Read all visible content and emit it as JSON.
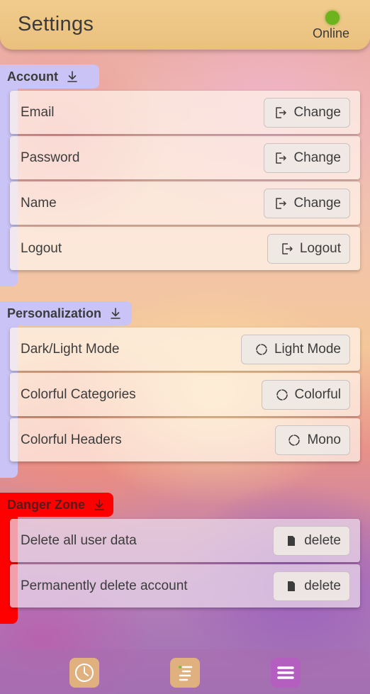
{
  "header": {
    "title": "Settings",
    "status": "Online",
    "status_color": "#6db31e"
  },
  "sections": {
    "account": {
      "title": "Account",
      "color": "#c9c3f6",
      "rows": [
        {
          "label": "Email",
          "button": "Change",
          "icon": "export-icon"
        },
        {
          "label": "Password",
          "button": "Change",
          "icon": "export-icon"
        },
        {
          "label": "Name",
          "button": "Change",
          "icon": "export-icon"
        },
        {
          "label": "Logout",
          "button": "Logout",
          "icon": "export-icon"
        }
      ]
    },
    "personalization": {
      "title": "Personalization",
      "color": "#c9c3f6",
      "rows": [
        {
          "label": "Dark/Light Mode",
          "button": "Light Mode",
          "icon": "refresh-icon"
        },
        {
          "label": "Colorful Categories",
          "button": "Colorful",
          "icon": "refresh-icon"
        },
        {
          "label": "Colorful Headers",
          "button": "Mono",
          "icon": "refresh-icon"
        }
      ]
    },
    "danger": {
      "title": "Danger Zone",
      "color": "#ff0000",
      "rows": [
        {
          "label": "Delete all user data",
          "button": "delete",
          "icon": "trash-icon"
        },
        {
          "label": "Permanently delete account",
          "button": "delete",
          "icon": "trash-icon"
        }
      ]
    }
  },
  "bottom_nav": {
    "items": [
      {
        "icon": "clock-icon",
        "color": "#e0b07f"
      },
      {
        "icon": "task-list-icon",
        "color": "#e0b07f"
      },
      {
        "icon": "menu-icon",
        "color": "#b45fc0",
        "active": true
      }
    ]
  }
}
